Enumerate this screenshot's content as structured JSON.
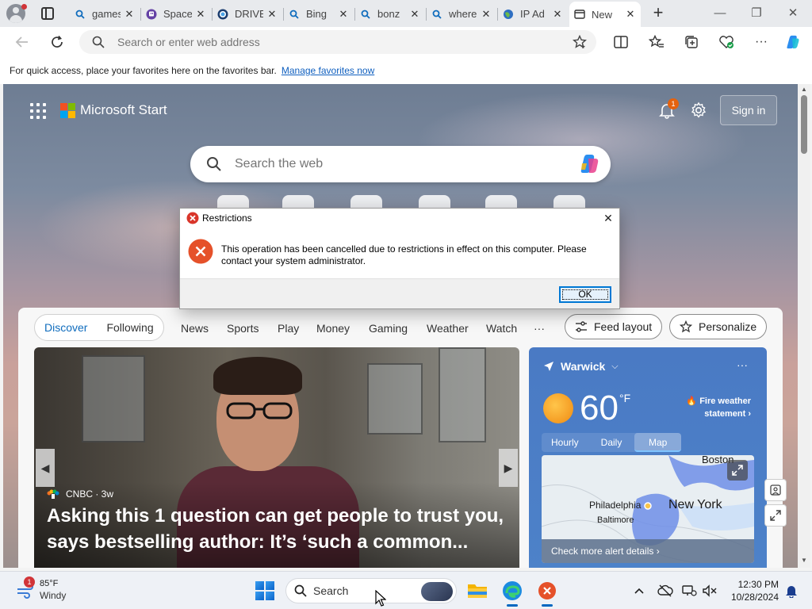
{
  "browser": {
    "tabs": [
      {
        "label": "games",
        "icon": "search-icon"
      },
      {
        "label": "Space",
        "icon": "twitch-icon"
      },
      {
        "label": "DRIVE",
        "icon": "drive-icon"
      },
      {
        "label": "Bing",
        "icon": "search-icon"
      },
      {
        "label": "bonz",
        "icon": "search-icon"
      },
      {
        "label": "where",
        "icon": "search-icon"
      },
      {
        "label": "IP Ad",
        "icon": "globe-icon"
      },
      {
        "label": "New",
        "icon": "newtab-icon",
        "active": true
      }
    ],
    "address": {
      "placeholder": "Search or enter web address"
    },
    "favorites_bar": {
      "text": "For quick access, place your favorites here on the favorites bar.",
      "link": "Manage favorites now"
    }
  },
  "page": {
    "brand": "Microsoft Start",
    "notifications_count": "1",
    "sign_in": "Sign in",
    "search_placeholder": "Search the web",
    "feed": {
      "primary_tabs": [
        "Discover",
        "Following"
      ],
      "nav": [
        "News",
        "Sports",
        "Play",
        "Money",
        "Gaming",
        "Weather",
        "Watch",
        "···"
      ],
      "feed_layout": "Feed layout",
      "personalize": "Personalize"
    },
    "hero": {
      "source": "CNBC · 3w",
      "headline": "Asking this 1 question can get people to trust you, says bestselling author: It’s ‘such a common..."
    },
    "weather": {
      "location": "Warwick",
      "more": "···",
      "temp": "60",
      "unit": "°F",
      "alert": "Fire weather statement",
      "tabs": [
        "Hourly",
        "Daily",
        "Map"
      ],
      "selected_tab": "Map",
      "map_labels": {
        "boston": "Boston",
        "philadelphia": "Philadelphia",
        "new_york": "New York",
        "baltimore": "Baltimore"
      },
      "alert_link": "Check more alert details"
    }
  },
  "dialog": {
    "title": "Restrictions",
    "message": "This operation has been cancelled due to restrictions in effect on this computer. Please contact your system administrator.",
    "ok": "OK"
  },
  "taskbar": {
    "weather_badge": "1",
    "temp": "85°F",
    "condition": "Windy",
    "search_label": "Search",
    "time": "12:30 PM",
    "date": "10/28/2024"
  },
  "colors": {
    "accent": "#0f6cbd",
    "dialog_error": "#e5512a",
    "weather_panel": "#4a7ac4"
  }
}
